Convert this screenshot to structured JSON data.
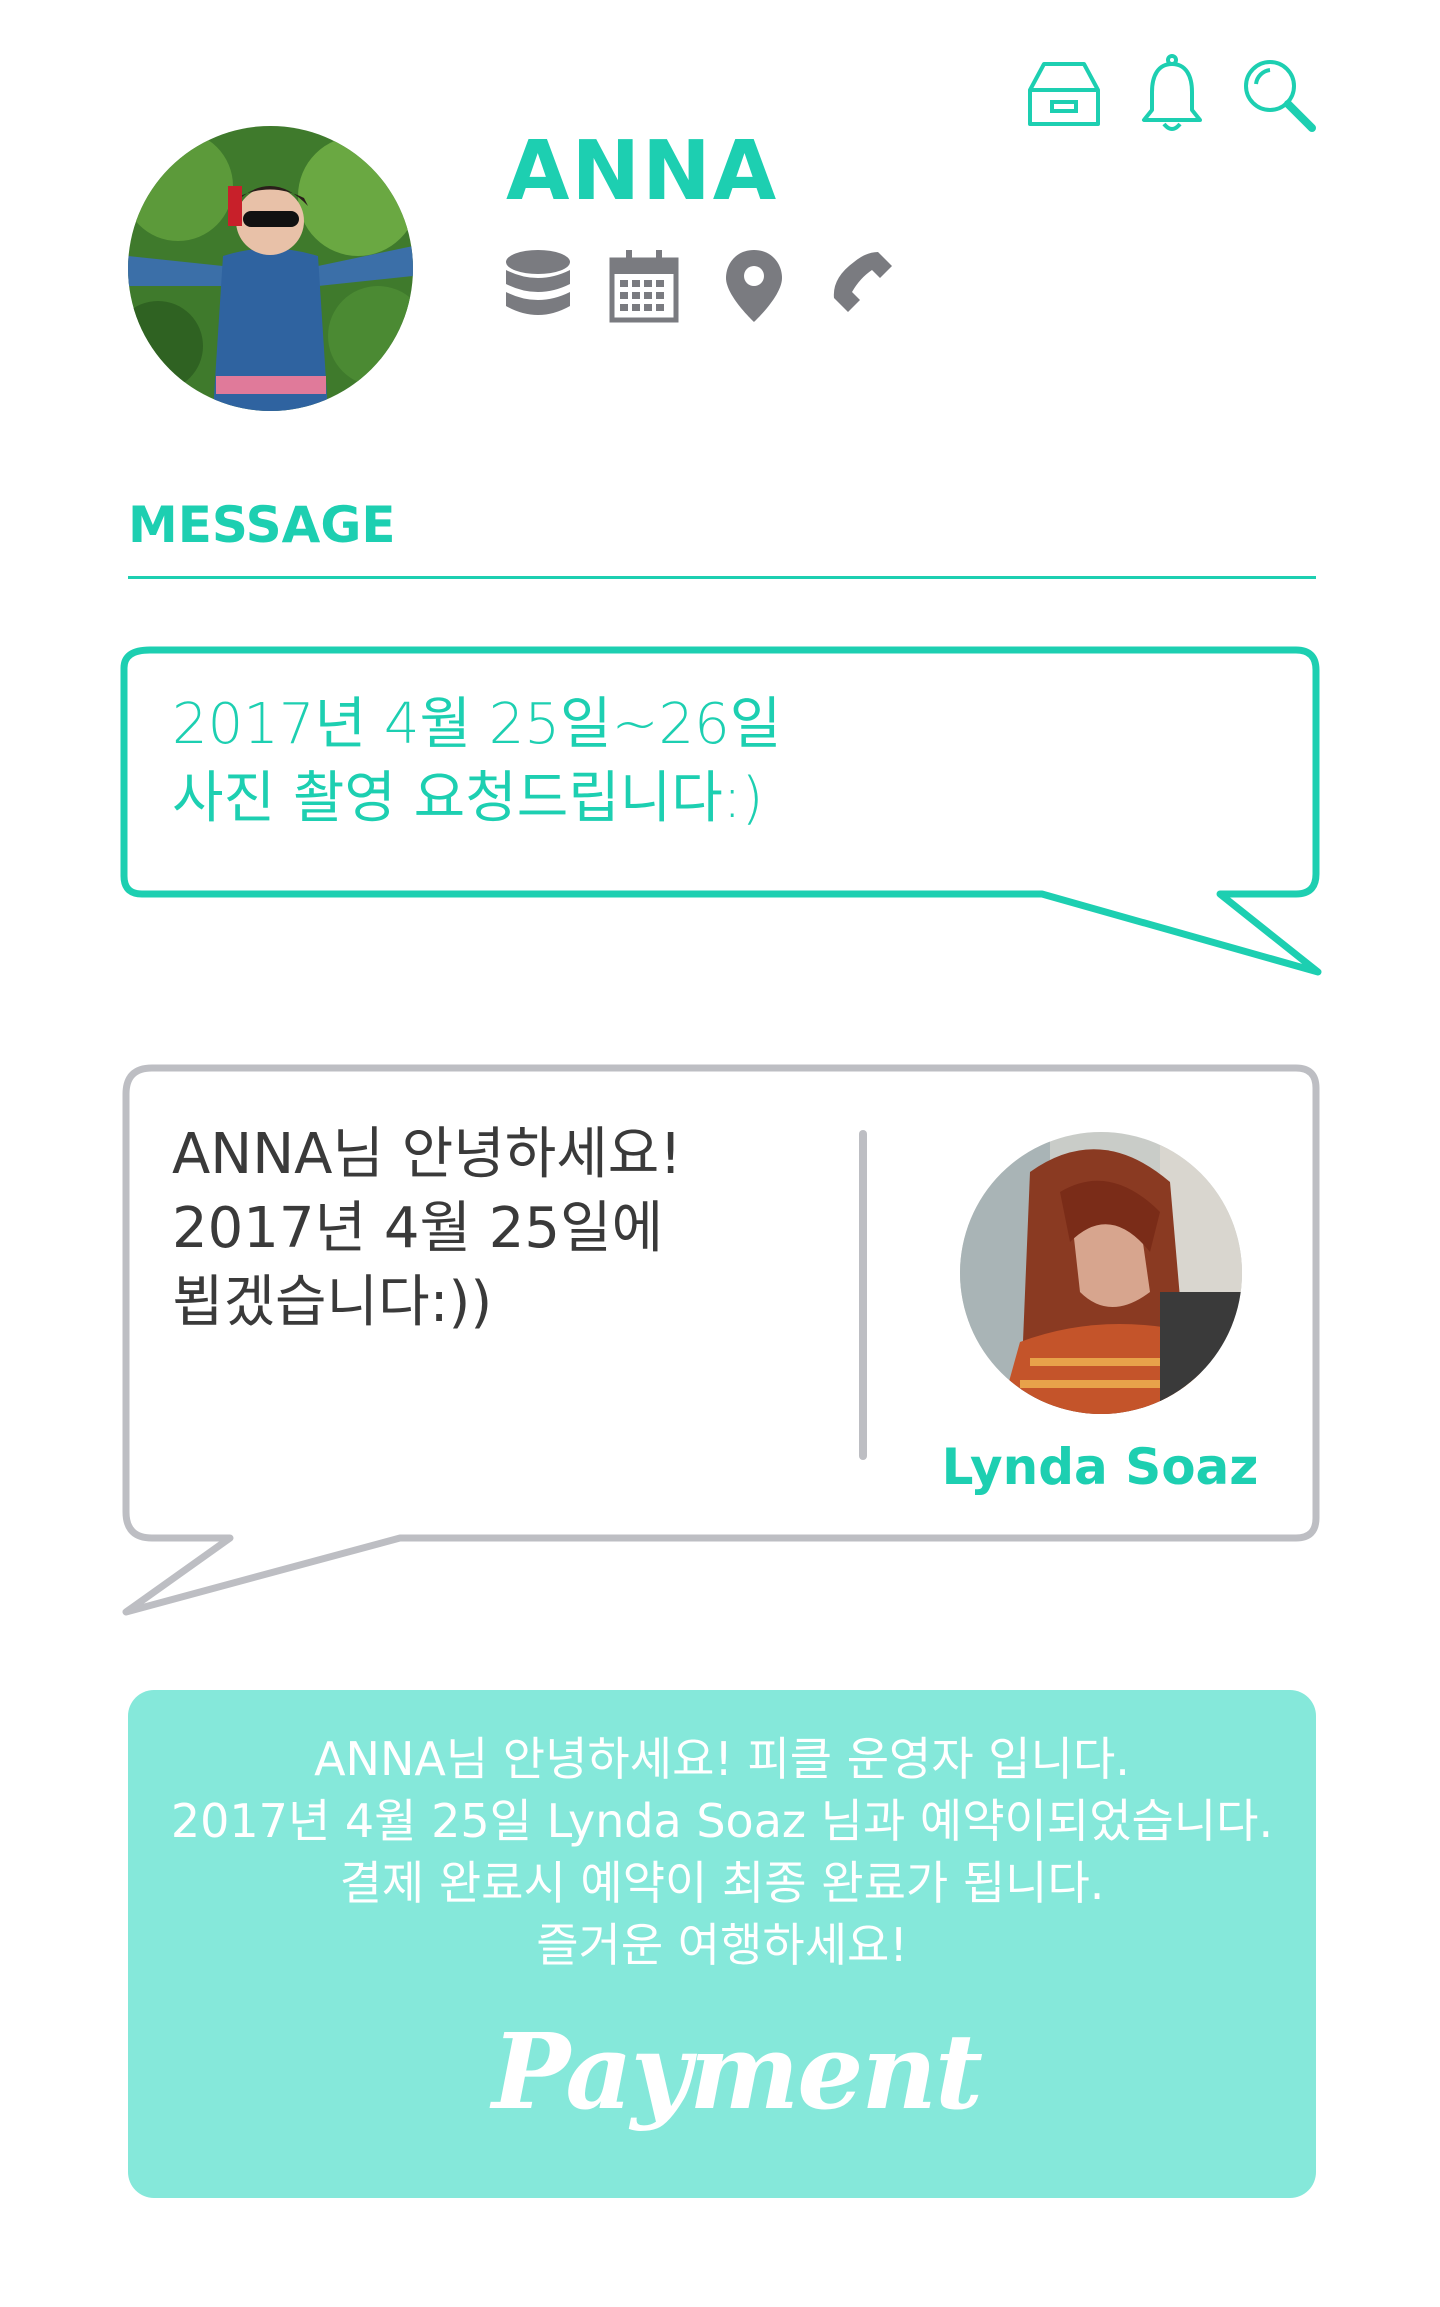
{
  "header": {
    "icons": [
      "inbox-icon",
      "bell-icon",
      "search-icon"
    ]
  },
  "profile": {
    "name": "ANNA",
    "icons": [
      "database-icon",
      "calendar-icon",
      "location-pin-icon",
      "phone-icon"
    ]
  },
  "message_section": {
    "title": "MESSAGE"
  },
  "request_bubble": {
    "text": "2017년 4월 25일~26일\n사진 촬영 요청드립니다:)"
  },
  "reply_bubble": {
    "text": "ANNA님 안녕하세요!\n2017년 4월 25일에\n뵙겠습니다:))",
    "sender_name": "Lynda Soaz"
  },
  "notice": {
    "text": "ANNA님 안녕하세요! 피클 운영자 입니다.\n2017년 4월 25일 Lynda Soaz 님과 예약이되었습니다.\n결제 완료시 예약이 최종 완료가 됩니다.\n즐거운 여행하세요!",
    "button_label": "Payment"
  },
  "colors": {
    "accent": "#1dcfb1",
    "notice_bg": "#85e8da",
    "icon_gray": "#7a7b80",
    "bubble_border": "#bdbec3"
  }
}
